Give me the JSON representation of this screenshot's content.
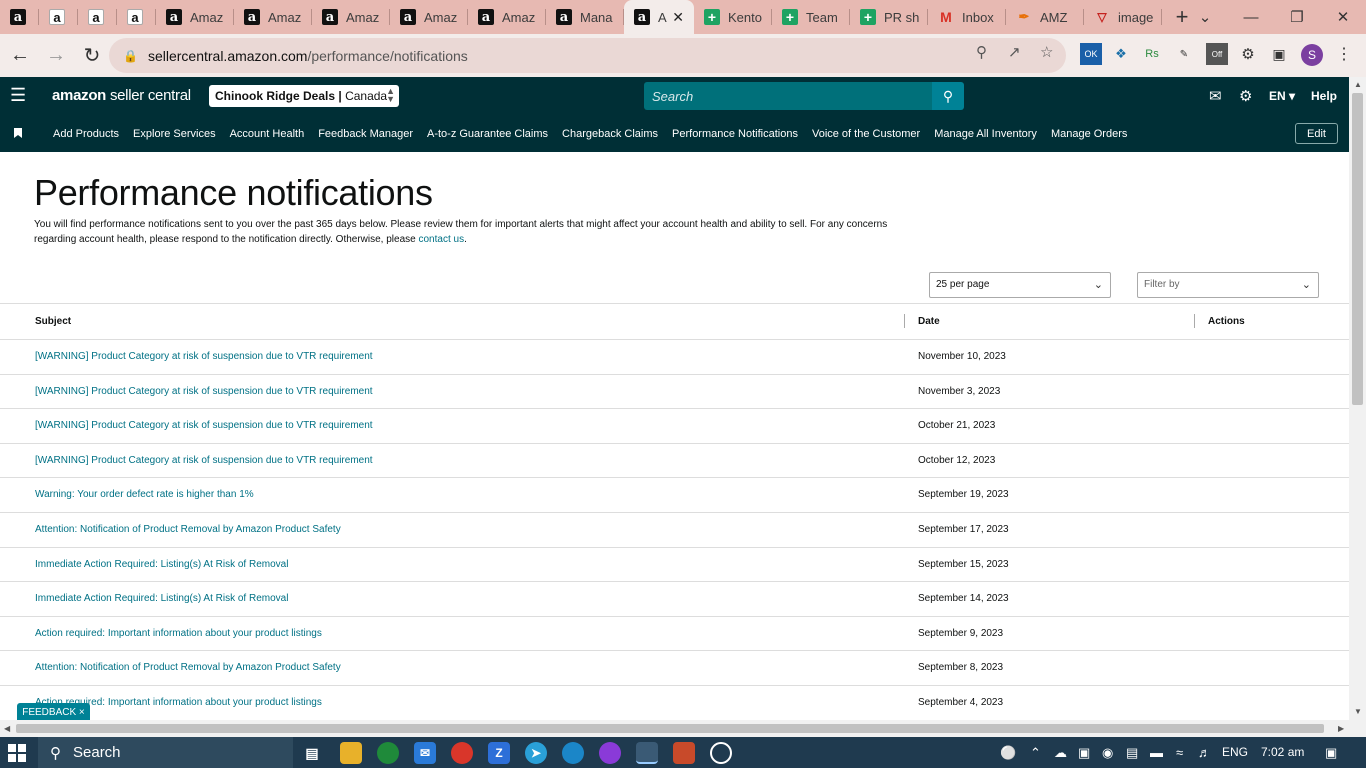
{
  "browser": {
    "tabs": [
      {
        "label": "",
        "icon": "amazon-icon"
      },
      {
        "label": "",
        "icon": "amazon-smile-icon"
      },
      {
        "label": "",
        "icon": "amazon-smile-icon"
      },
      {
        "label": "",
        "icon": "amazon-smile-icon"
      },
      {
        "label": "Amaz",
        "icon": "amazon-icon"
      },
      {
        "label": "Amaz",
        "icon": "amazon-icon"
      },
      {
        "label": "Amaz",
        "icon": "amazon-icon"
      },
      {
        "label": "Amaz",
        "icon": "amazon-icon"
      },
      {
        "label": "Amaz",
        "icon": "amazon-icon"
      },
      {
        "label": "Mana",
        "icon": "amazon-icon"
      },
      {
        "label": "A",
        "icon": "amazon-icon",
        "active": true
      },
      {
        "label": "Kento",
        "icon": "sheets-icon"
      },
      {
        "label": "Team",
        "icon": "sheets-icon"
      },
      {
        "label": "PR sh",
        "icon": "sheets-icon"
      },
      {
        "label": "Inbox",
        "icon": "gmail-icon"
      },
      {
        "label": "AMZ",
        "icon": "pencil-icon"
      },
      {
        "label": "image",
        "icon": "triangle-icon"
      }
    ],
    "url_host": "sellercentral.amazon.com",
    "url_path": "/performance/notifications",
    "profile_initial": "S",
    "ext_badge_ok": "OK",
    "ext_badge_off": "Off"
  },
  "header": {
    "logo_brand": "amazon",
    "logo_text": "seller central",
    "store_name": "Chinook Ridge Deals",
    "store_region": "Canada",
    "search_placeholder": "Search",
    "language": "EN",
    "help": "Help"
  },
  "nav": {
    "links": [
      "Add Products",
      "Explore Services",
      "Account Health",
      "Feedback Manager",
      "A-to-z Guarantee Claims",
      "Chargeback Claims",
      "Performance Notifications",
      "Voice of the Customer",
      "Manage All Inventory",
      "Manage Orders"
    ],
    "edit": "Edit"
  },
  "page": {
    "title": "Performance notifications",
    "intro": "You will find performance notifications sent to you over the past 365 days below. Please review them for important alerts that might affect your account health and ability to sell. For any concerns regarding account health, please respond to the notification directly. Otherwise, please ",
    "intro_link": "contact us",
    "intro_end": ".",
    "per_page": "25 per page",
    "filter_placeholder": "Filter by",
    "columns": {
      "subject": "Subject",
      "date": "Date",
      "actions": "Actions"
    },
    "rows": [
      {
        "subject": "[WARNING] Product Category at risk of suspension due to VTR requirement",
        "date": "November 10, 2023"
      },
      {
        "subject": "[WARNING] Product Category at risk of suspension due to VTR requirement",
        "date": "November 3, 2023"
      },
      {
        "subject": "[WARNING] Product Category at risk of suspension due to VTR requirement",
        "date": "October 21, 2023"
      },
      {
        "subject": "[WARNING] Product Category at risk of suspension due to VTR requirement",
        "date": "October 12, 2023"
      },
      {
        "subject": "Warning: Your order defect rate is higher than 1%",
        "date": "September 19, 2023"
      },
      {
        "subject": "Attention: Notification of Product Removal by Amazon Product Safety",
        "date": "September 17, 2023"
      },
      {
        "subject": "Immediate Action Required: Listing(s) At Risk of Removal",
        "date": "September 15, 2023"
      },
      {
        "subject": "Immediate Action Required: Listing(s) At Risk of Removal",
        "date": "September 14, 2023"
      },
      {
        "subject": "Action required: Important information about your product listings",
        "date": "September 9, 2023"
      },
      {
        "subject": "Attention: Notification of Product Removal by Amazon Product Safety",
        "date": "September 8, 2023"
      },
      {
        "subject": "Action required: Important information about your product listings",
        "date": "September 4, 2023"
      }
    ],
    "feedback": "FEEDBACK ×"
  },
  "taskbar": {
    "search": "Search",
    "language": "ENG",
    "time": "7:02 am"
  },
  "colors": {
    "header_bg": "#002f36",
    "link": "#007185",
    "search_bg": "#00707a",
    "accent": "#008296",
    "tabstrip": "#e7b9b2"
  }
}
